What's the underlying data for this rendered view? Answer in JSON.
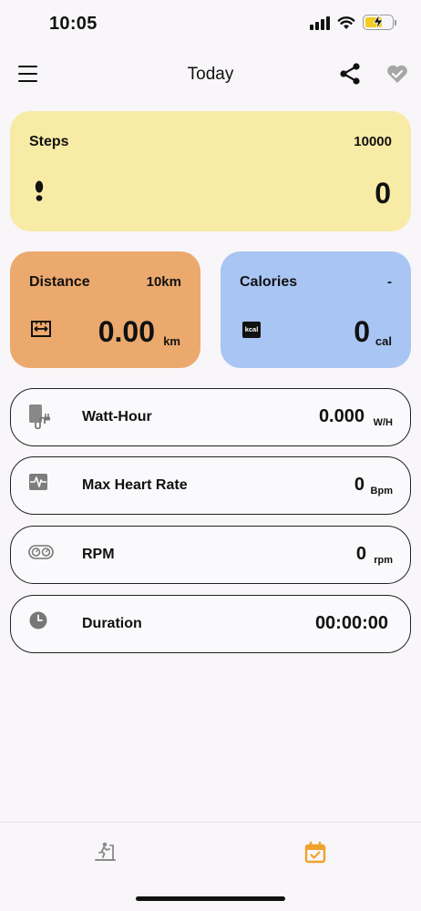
{
  "status_bar": {
    "time": "10:05"
  },
  "header": {
    "title": "Today"
  },
  "steps": {
    "label": "Steps",
    "goal": "10000",
    "value": "0"
  },
  "distance": {
    "label": "Distance",
    "goal": "10km",
    "value": "0.00",
    "unit": "km"
  },
  "calories": {
    "label": "Calories",
    "goal": "-",
    "value": "0",
    "unit": "cal",
    "icon_text": "kcal"
  },
  "metrics": [
    {
      "label": "Watt-Hour",
      "value": "0.000",
      "unit": "W/H",
      "icon": "battery-plug-icon"
    },
    {
      "label": "Max Heart Rate",
      "value": "0",
      "unit": "Bpm",
      "icon": "heartbeat-icon"
    },
    {
      "label": "RPM",
      "value": "0",
      "unit": "rpm",
      "icon": "rpm-gauge-icon"
    },
    {
      "label": "Duration",
      "value": "00:00:00",
      "unit": "",
      "icon": "clock-icon"
    }
  ],
  "tabs": [
    {
      "name": "workout",
      "icon": "treadmill-icon",
      "active": false
    },
    {
      "name": "today",
      "icon": "calendar-check-icon",
      "active": true
    }
  ],
  "colors": {
    "steps_card": "#f8eba6",
    "distance_card": "#eca96d",
    "calories_card": "#a9c5f3",
    "accent": "#f0a12c",
    "inactive_icon": "#9a9a9a"
  }
}
